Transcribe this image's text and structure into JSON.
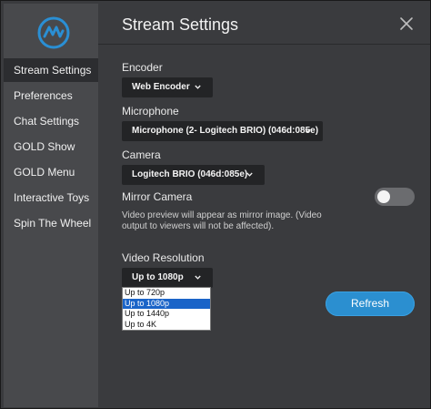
{
  "window": {
    "title": "Stream Settings"
  },
  "sidebar": {
    "items": [
      {
        "label": "Stream Settings",
        "active": true
      },
      {
        "label": "Preferences"
      },
      {
        "label": "Chat Settings"
      },
      {
        "label": "GOLD Show"
      },
      {
        "label": "GOLD Menu"
      },
      {
        "label": "Interactive Toys"
      },
      {
        "label": "Spin The Wheel"
      }
    ]
  },
  "encoder": {
    "label": "Encoder",
    "value": "Web Encoder"
  },
  "microphone": {
    "label": "Microphone",
    "value": "Microphone (2- Logitech BRIO) (046d:085e)"
  },
  "camera": {
    "label": "Camera",
    "value": "Logitech BRIO (046d:085e)"
  },
  "mirror": {
    "label": "Mirror Camera",
    "enabled": false,
    "note": "Video preview will appear as mirror image. (Video output to viewers will not be affected)."
  },
  "resolution": {
    "label": "Video Resolution",
    "value": "Up to 1080p",
    "options": [
      "Up to 720p",
      "Up to 1080p",
      "Up to 1440p",
      "Up to 4K"
    ],
    "selected_index": 1
  },
  "refresh_label": "Refresh",
  "colors": {
    "accent": "#2b8fd0",
    "logo": "#2a8fd4",
    "selection": "#1a64c8",
    "sidebar_bg": "#48494c",
    "panel_bg": "#3a3b3e"
  },
  "icons": {
    "logo": "logo-icon",
    "close": "close-icon",
    "dropdown": "chevron-down-icon"
  }
}
